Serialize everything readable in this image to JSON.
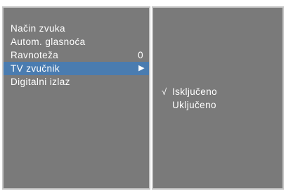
{
  "menu": {
    "items": [
      {
        "label": "Način zvuka",
        "value": "",
        "arrow": ""
      },
      {
        "label": "Autom. glasnoća",
        "value": "",
        "arrow": ""
      },
      {
        "label": "Ravnoteža",
        "value": "0",
        "arrow": ""
      },
      {
        "label": "TV zvučnik",
        "value": "",
        "arrow": "▶"
      },
      {
        "label": "Digitalni izlaz",
        "value": "",
        "arrow": ""
      }
    ],
    "selected_index": 3
  },
  "submenu": {
    "options": [
      {
        "label": "Isključeno",
        "check": "√"
      },
      {
        "label": "Uključeno",
        "check": ""
      }
    ]
  },
  "colors": {
    "panel": "#7a7a7a",
    "panel_border": "#c8c8c8",
    "highlight": "#4a7cb0",
    "text": "#ffffff"
  },
  "icons": {
    "submenu_arrow": "play-arrow-icon",
    "selected_check": "check-icon"
  }
}
